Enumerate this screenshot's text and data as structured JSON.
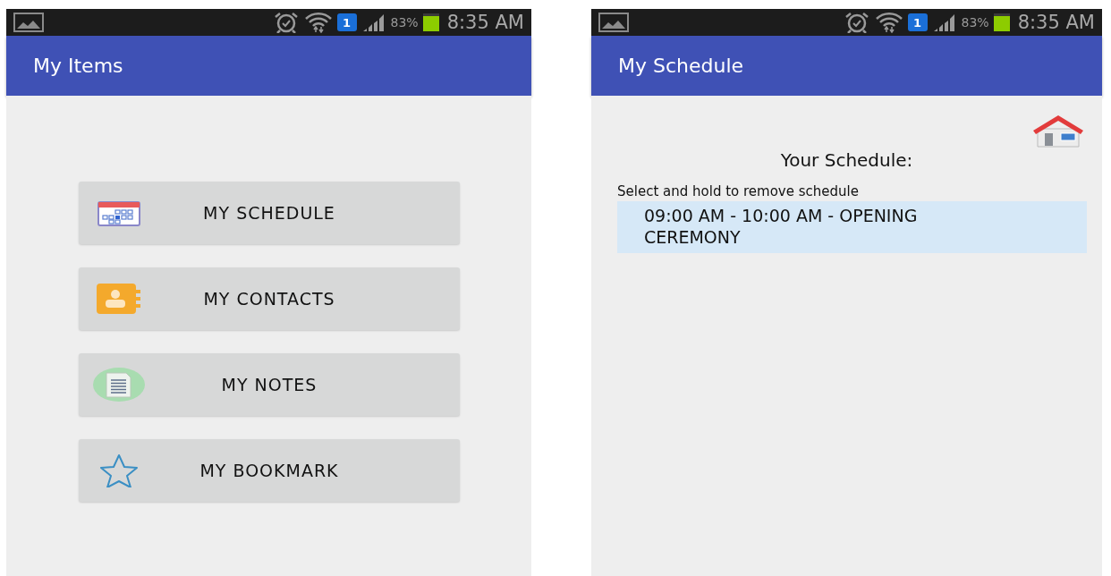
{
  "screens": [
    {
      "status_bar": {
        "sim": "1",
        "battery": "83%",
        "time": "8:35 AM"
      },
      "app_bar": {
        "title": "My Items"
      },
      "menu": [
        {
          "kind": "calendar",
          "label": "MY SCHEDULE"
        },
        {
          "kind": "contacts",
          "label": "MY CONTACTS"
        },
        {
          "kind": "notes",
          "label": "MY NOTES"
        },
        {
          "kind": "star",
          "label": "MY BOOKMARK"
        }
      ]
    },
    {
      "status_bar": {
        "sim": "1",
        "battery": "83%",
        "time": "8:35 AM"
      },
      "app_bar": {
        "title": "My Schedule"
      },
      "heading": "Your Schedule:",
      "hint": "Select and hold to remove schedule",
      "schedule": [
        {
          "text": "09:00 AM - 10:00 AM - OPENING CEREMONY"
        }
      ]
    }
  ]
}
